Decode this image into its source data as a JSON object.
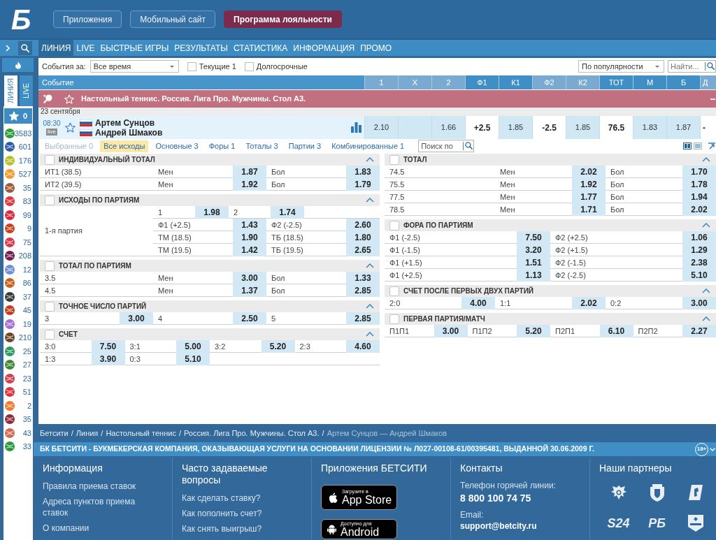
{
  "header": {
    "logo": "Б",
    "buttons": [
      {
        "label": "Приложения",
        "kind": "outline"
      },
      {
        "label": "Мобильный сайт",
        "kind": "outline"
      },
      {
        "label": "Программа лояльности",
        "kind": "promo"
      }
    ]
  },
  "nav": {
    "items": [
      {
        "label": "ЛИНИЯ",
        "selected": true
      },
      {
        "label": "LIVE",
        "selected": false
      },
      {
        "label": "БЫСТРЫЕ ИГРЫ",
        "selected": false
      },
      {
        "label": "РЕЗУЛЬТАТЫ",
        "selected": false
      },
      {
        "label": "СТАТИСТИКА",
        "selected": false
      },
      {
        "label": "ИНФОРМАЦИЯ",
        "selected": false
      },
      {
        "label": "ПРОМО",
        "selected": false
      }
    ]
  },
  "sidebar": {
    "tabs": [
      {
        "label": "ЛИНИЯ",
        "selected": true
      },
      {
        "label": "LIVE",
        "selected": false
      }
    ],
    "favorites": {
      "count": "0"
    },
    "sports": [
      {
        "count": "3583",
        "color": "#2e9c3e"
      },
      {
        "count": "601",
        "color": "#2a5caa"
      },
      {
        "count": "176",
        "color": "#b8c12a"
      },
      {
        "count": "527",
        "color": "#f39a2b"
      },
      {
        "count": "35",
        "color": "#9b5a3a"
      },
      {
        "count": "83",
        "color": "#e0353c"
      },
      {
        "count": "99",
        "color": "#d8283c"
      },
      {
        "count": "9",
        "color": "#c4441e"
      },
      {
        "count": "75",
        "color": "#d63a4c"
      },
      {
        "count": "208",
        "color": "#6e1f4c"
      },
      {
        "count": "12",
        "color": "#6d8fdc"
      },
      {
        "count": "86",
        "color": "#c8601c"
      },
      {
        "count": "37",
        "color": "#3a3a3a"
      },
      {
        "count": "45",
        "color": "#c53b1c"
      },
      {
        "count": "19",
        "color": "#a56fd8"
      },
      {
        "count": "210",
        "color": "#6a4528"
      },
      {
        "count": "25",
        "color": "#2b9a5c"
      },
      {
        "count": "27",
        "color": "#3c8a36"
      },
      {
        "count": "23",
        "color": "#d2404e"
      },
      {
        "count": "51",
        "color": "#e2303c"
      },
      {
        "count": "2",
        "color": "#f27a2c"
      },
      {
        "count": "35",
        "color": "#8c2c3c"
      },
      {
        "count": "43",
        "color": "#d26a52"
      },
      {
        "count": "33",
        "color": "#2a9a38"
      }
    ]
  },
  "filters": {
    "period_label": "События за:",
    "period": "Все время",
    "checkboxes": [
      {
        "label": "Текущие 1",
        "checked": false
      },
      {
        "label": "Долгосрочные",
        "checked": false
      }
    ],
    "sort": "По популярности",
    "search": {
      "placeholder": "Найти..."
    }
  },
  "table": {
    "event_column": "Событие",
    "columns": [
      {
        "label": "1",
        "color": "#7aaad1"
      },
      {
        "label": "X",
        "color": "#7aaad1"
      },
      {
        "label": "2",
        "color": "#7aaad1"
      },
      {
        "label": "Ф1",
        "color": "#3f8fc6"
      },
      {
        "label": "К1",
        "color": "#3f8fc6"
      },
      {
        "label": "Ф2",
        "color": "#7aaad1"
      },
      {
        "label": "К2",
        "color": "#7aaad1"
      },
      {
        "label": "ТОТ",
        "color": "#3f8fc6"
      },
      {
        "label": "М",
        "color": "#3f8fc6"
      },
      {
        "label": "Б",
        "color": "#3f8fc6"
      },
      {
        "label": "Д",
        "color": "#7aaad1"
      }
    ],
    "league": "Настольный теннис. Россия. Лига Про. Мужчины. Стол А3.",
    "date": "23 сентября",
    "event": {
      "time": "08:30",
      "badge": "live",
      "favorite": false,
      "teams": [
        "Артем Сунцов",
        "Андрей Шмаков"
      ],
      "cells": [
        {
          "kind": "odd",
          "value": "2.10"
        },
        {
          "kind": "odd"
        },
        {
          "kind": "odd",
          "value": "1.66"
        },
        {
          "kind": "line",
          "value": "+2.5"
        },
        {
          "kind": "odd",
          "value": "1.85"
        },
        {
          "kind": "line",
          "value": "-2.5"
        },
        {
          "kind": "odd",
          "value": "1.85"
        },
        {
          "kind": "line",
          "value": "76.5"
        },
        {
          "kind": "odd",
          "value": "1.83"
        },
        {
          "kind": "odd",
          "value": "1.87"
        },
        {
          "kind": "line",
          "value": "-"
        }
      ]
    }
  },
  "market_tabs": {
    "items": [
      {
        "label": "Выбранные 0",
        "selected": false,
        "disabled": true
      },
      {
        "label": "Все исходы",
        "selected": true,
        "disabled": false
      },
      {
        "label": "Основные 3",
        "selected": false,
        "disabled": false
      },
      {
        "label": "Форы 1",
        "selected": false,
        "disabled": false
      },
      {
        "label": "Тоталы 3",
        "selected": false,
        "disabled": false
      },
      {
        "label": "Партии 3",
        "selected": false,
        "disabled": false
      },
      {
        "label": "Комбинированные 1",
        "selected": false,
        "disabled": false
      }
    ],
    "search": {
      "placeholder": "Поиск по"
    },
    "layouts": [
      {
        "kind": "two-column",
        "selected": true
      },
      {
        "kind": "one-column",
        "selected": false
      }
    ]
  },
  "markets": {
    "left": [
      {
        "title": "ИНДИВИДУАЛЬНЫЙ ТОТАЛ",
        "checked": false,
        "expanded": true,
        "rows": [
          [
            {
              "label": "ИТ1 (38.5)"
            },
            {
              "label": "Мен",
              "odd": "1.87"
            },
            {
              "label": "Бол",
              "odd": "1.83"
            }
          ],
          [
            {
              "label": "ИТ2 (39.5)"
            },
            {
              "label": "Мен",
              "odd": "1.92"
            },
            {
              "label": "Бол",
              "odd": "1.79"
            }
          ]
        ]
      },
      {
        "title": "ИСХОДЫ ПО ПАРТИЯМ",
        "checked": false,
        "expanded": true,
        "period": "1-я партия",
        "lines": [
          {
            "kind": "compact",
            "cells": [
              {
                "label": "1",
                "odd": "1.98"
              },
              {
                "label": "2",
                "odd": "1.74"
              }
            ]
          },
          {
            "kind": "full",
            "cells": [
              {
                "label": "Ф1 (+2.5)",
                "odd": "1.43"
              },
              {
                "label": "Ф2 (-2.5)",
                "odd": "2.60"
              }
            ]
          },
          {
            "kind": "full",
            "cells": [
              {
                "label": "ТМ (18.5)",
                "odd": "1.90"
              },
              {
                "label": "ТБ (18.5)",
                "odd": "1.80"
              }
            ]
          },
          {
            "kind": "full",
            "cells": [
              {
                "label": "ТМ (19.5)",
                "odd": "1.42"
              },
              {
                "label": "ТБ (19.5)",
                "odd": "2.65"
              }
            ]
          }
        ]
      },
      {
        "title": "ТОТАЛ ПО ПАРТИЯМ",
        "checked": false,
        "expanded": true,
        "rows": [
          [
            {
              "label": "3.5"
            },
            {
              "label": "Мен",
              "odd": "3.00"
            },
            {
              "label": "Бол",
              "odd": "1.33"
            }
          ],
          [
            {
              "label": "4.5"
            },
            {
              "label": "Мен",
              "odd": "1.37"
            },
            {
              "label": "Бол",
              "odd": "2.85"
            }
          ]
        ]
      },
      {
        "title": "ТОЧНОЕ ЧИСЛО ПАРТИЙ",
        "checked": false,
        "expanded": true,
        "rows": [
          [
            {
              "label": "3",
              "odd": "3.00"
            },
            {
              "label": "4",
              "odd": "2.50"
            },
            {
              "label": "5",
              "odd": "2.85"
            }
          ]
        ]
      },
      {
        "title": "СЧЕТ",
        "checked": false,
        "expanded": true,
        "rows": [
          [
            {
              "label": "3:0",
              "odd": "7.50"
            },
            {
              "label": "3:1",
              "odd": "5.00"
            },
            {
              "label": "3:2",
              "odd": "5.20"
            },
            {
              "label": "2:3",
              "odd": "4.60"
            }
          ],
          [
            {
              "label": "1:3",
              "odd": "3.90"
            },
            {
              "label": "0:3",
              "odd": "5.10"
            }
          ]
        ]
      }
    ],
    "right": [
      {
        "title": "ТОТАЛ",
        "checked": false,
        "expanded": true,
        "rows": [
          [
            {
              "label": "74.5"
            },
            {
              "label": "Мен",
              "odd": "2.02"
            },
            {
              "label": "Бол",
              "odd": "1.70"
            }
          ],
          [
            {
              "label": "75.5"
            },
            {
              "label": "Мен",
              "odd": "1.92"
            },
            {
              "label": "Бол",
              "odd": "1.78"
            }
          ],
          [
            {
              "label": "77.5"
            },
            {
              "label": "Мен",
              "odd": "1.77"
            },
            {
              "label": "Бол",
              "odd": "1.94"
            }
          ],
          [
            {
              "label": "78.5"
            },
            {
              "label": "Мен",
              "odd": "1.71"
            },
            {
              "label": "Бол",
              "odd": "2.02"
            }
          ]
        ]
      },
      {
        "title": "ФОРА ПО ПАРТИЯМ",
        "checked": false,
        "expanded": true,
        "rows": [
          [
            {
              "label": "Ф1 (-2.5)",
              "odd": "7.50"
            },
            {
              "label": "Ф2 (+2.5)",
              "odd": "1.06"
            }
          ],
          [
            {
              "label": "Ф1 (-1.5)",
              "odd": "3.20"
            },
            {
              "label": "Ф2 (+1.5)",
              "odd": "1.29"
            }
          ],
          [
            {
              "label": "Ф1 (+1.5)",
              "odd": "1.51"
            },
            {
              "label": "Ф2 (-1.5)",
              "odd": "2.38"
            }
          ],
          [
            {
              "label": "Ф1 (+2.5)",
              "odd": "1.13"
            },
            {
              "label": "Ф2 (-2.5)",
              "odd": "5.10"
            }
          ]
        ]
      },
      {
        "title": "СЧЕТ ПОСЛЕ ПЕРВЫХ ДВУХ ПАРТИЙ",
        "checked": false,
        "expanded": true,
        "rows": [
          [
            {
              "label": "2:0",
              "odd": "4.00"
            },
            {
              "label": "1:1",
              "odd": "2.02"
            },
            {
              "label": "0:2",
              "odd": "3.00"
            }
          ]
        ]
      },
      {
        "title": "ПЕРВАЯ ПАРТИЯ/МАТЧ",
        "checked": false,
        "expanded": true,
        "rows": [
          [
            {
              "label": "П1П1",
              "odd": "3.00"
            },
            {
              "label": "П1П2",
              "odd": "5.20"
            },
            {
              "label": "П2П1",
              "odd": "6.10"
            },
            {
              "label": "П2П2",
              "odd": "2.27"
            }
          ]
        ]
      }
    ]
  },
  "breadcrumb": [
    {
      "kind": "link",
      "text": "Бетсити"
    },
    {
      "kind": "separator",
      "text": "/"
    },
    {
      "kind": "link",
      "text": "Линия"
    },
    {
      "kind": "separator",
      "text": "/"
    },
    {
      "kind": "link",
      "text": "Настольный теннис"
    },
    {
      "kind": "separator",
      "text": "/"
    },
    {
      "kind": "link",
      "text": "Россия. Лига Про. Мужчины. Стол А3."
    },
    {
      "kind": "separator",
      "text": "/"
    },
    {
      "kind": "current",
      "text": "Артем Сунцов — Андрей Шмаков"
    }
  ],
  "license": {
    "text": "БК БЕТСИТИ - БУКМЕКЕРСКАЯ КОМПАНИЯ, ОКАЗЫВАЮЩАЯ УСЛУГИ НА ОСНОВАНИИ ЛИЦЕНЗИИ № Л027-00108-61/00395481, ВЫДАННОЙ 30.06.2009 Г.",
    "age_limit": "18+"
  },
  "footer": {
    "columns": [
      {
        "title": "Информация",
        "kind": "links",
        "links": [
          "Правила приема ставок",
          "Адреса пунктов приема ставок",
          "О компании"
        ]
      },
      {
        "title": "Часто задаваемые вопросы",
        "kind": "links",
        "links": [
          "Как сделать ставку?",
          "Как пополнить счет?",
          "Как снять выигрыш?"
        ]
      },
      {
        "title": "Приложения БЕТСИТИ",
        "kind": "apps",
        "apps": [
          {
            "kind": "apple",
            "caption": "Загрузите в",
            "name": "App Store"
          },
          {
            "kind": "android",
            "caption": "Доступно для",
            "name": "Android"
          }
        ]
      },
      {
        "title": "Контакты",
        "kind": "contacts",
        "contacts": [
          {
            "label": "Телефон горячей линии:",
            "value": "8 800 100 74 75"
          },
          {
            "label": "Email:",
            "value": "support@betcity.ru"
          }
        ]
      },
      {
        "title": "Наши партнеры",
        "kind": "partners",
        "partners": [
          {
            "kind": "emblem"
          },
          {
            "kind": "crest"
          },
          {
            "kind": "badge"
          },
          {
            "kind": "wordmark",
            "text": "S24"
          },
          {
            "kind": "wordmark",
            "text": "РБ"
          },
          {
            "kind": "shield"
          }
        ]
      }
    ]
  }
}
